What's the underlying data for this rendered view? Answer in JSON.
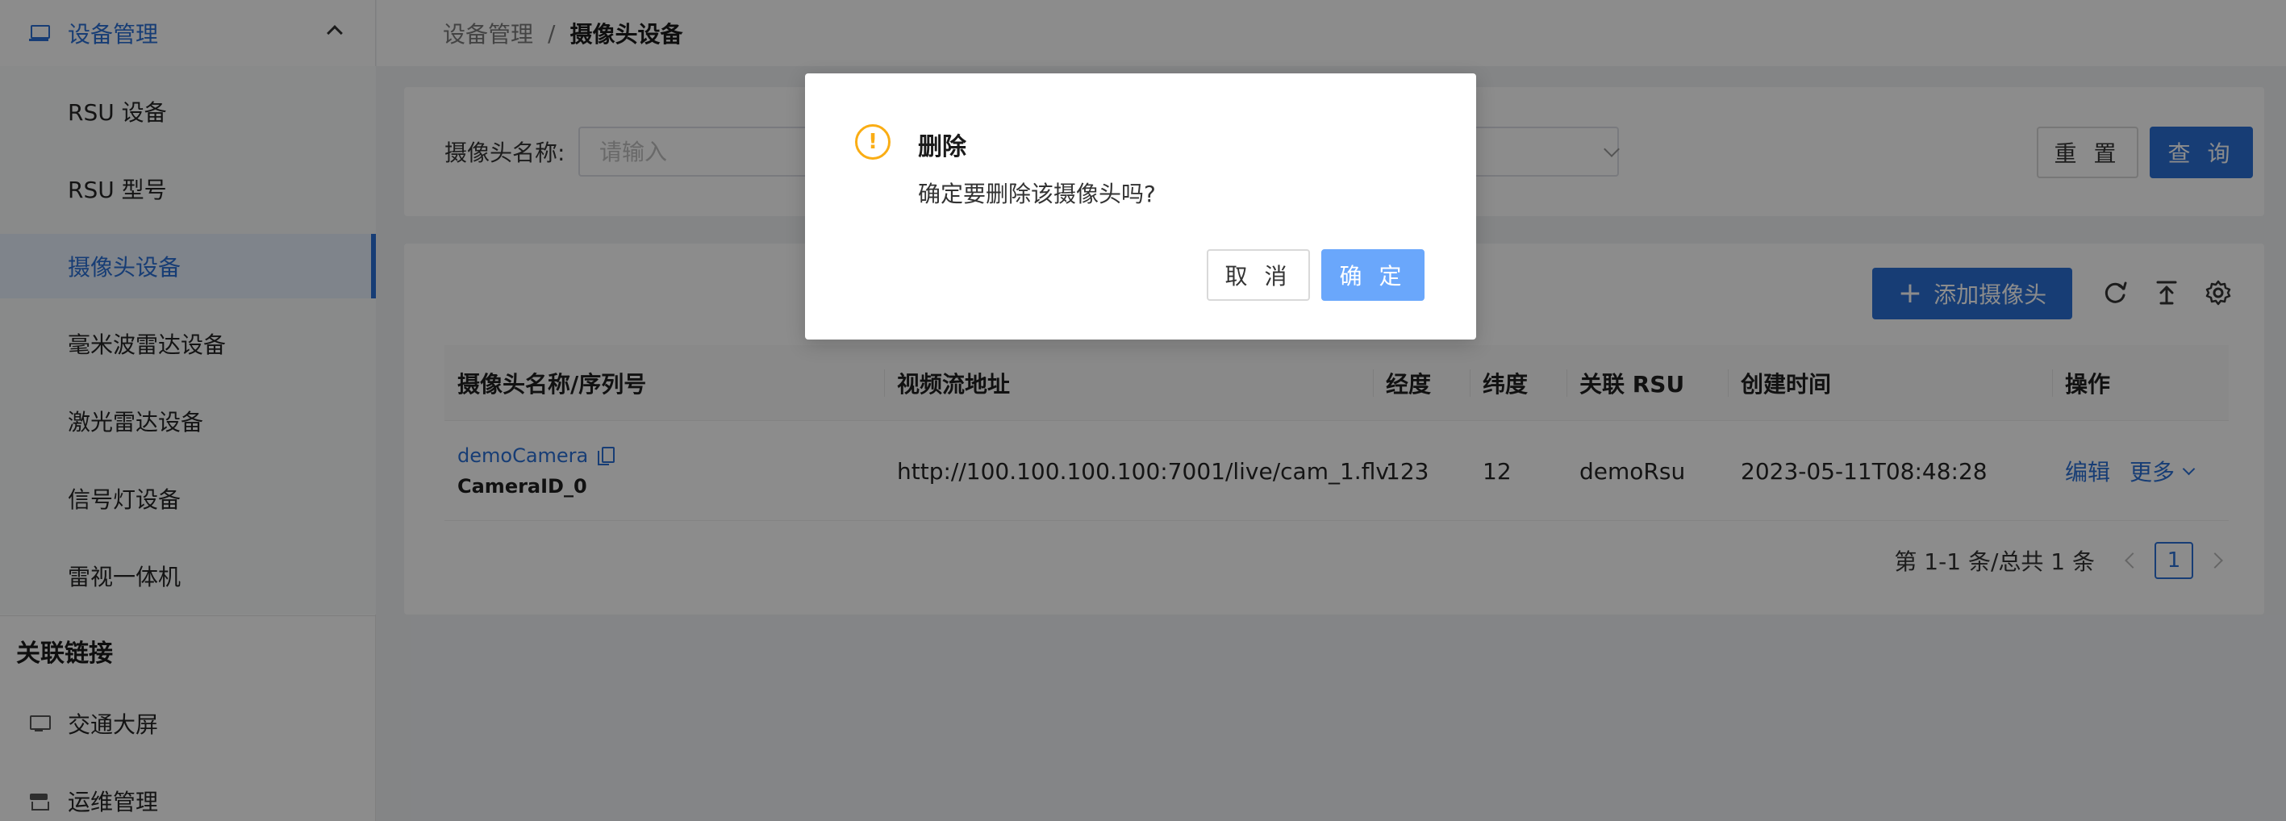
{
  "sidebar": {
    "group_title": "设备管理",
    "items": [
      {
        "label": "RSU 设备"
      },
      {
        "label": "RSU 型号"
      },
      {
        "label": "摄像头设备"
      },
      {
        "label": "毫米波雷达设备"
      },
      {
        "label": "激光雷达设备"
      },
      {
        "label": "信号灯设备"
      },
      {
        "label": "雷视一体机"
      }
    ],
    "active_item": "摄像头设备",
    "section_title": "关联链接",
    "links": [
      {
        "label": "交通大屏",
        "icon": "monitor-icon"
      },
      {
        "label": "运维管理",
        "icon": "shop-icon"
      }
    ]
  },
  "breadcrumb": {
    "parent": "设备管理",
    "separator": "/",
    "current": "摄像头设备"
  },
  "search": {
    "label": "摄像头名称:",
    "placeholder": "请输入",
    "reset_label": "重 置",
    "query_label": "查 询"
  },
  "toolbar": {
    "add_label": "添加摄像头",
    "icons": [
      "refresh-icon",
      "export-icon",
      "settings-icon"
    ]
  },
  "table": {
    "columns": [
      "摄像头名称/序列号",
      "视频流地址",
      "经度",
      "纬度",
      "关联 RSU",
      "创建时间",
      "操作"
    ],
    "rows": [
      {
        "name": "demoCamera",
        "serial": "CameraID_0",
        "stream_url": "http://100.100.100.100:7001/live/cam_1.flv",
        "longitude": "123",
        "latitude": "12",
        "rsu": "demoRsu",
        "created_at": "2023-05-11T08:48:28",
        "edit_label": "编辑",
        "more_label": "更多"
      }
    ]
  },
  "pagination": {
    "total_text": "第 1-1 条/总共 1 条",
    "current_page": "1"
  },
  "modal": {
    "icon": "warning-icon",
    "title": "删除",
    "content": "确定要删除该摄像头吗?",
    "cancel_label": "取 消",
    "ok_label": "确 定"
  },
  "colors": {
    "primary": "#2a6fd6",
    "primary_light": "#6aa7fb",
    "warning": "#faad14"
  }
}
